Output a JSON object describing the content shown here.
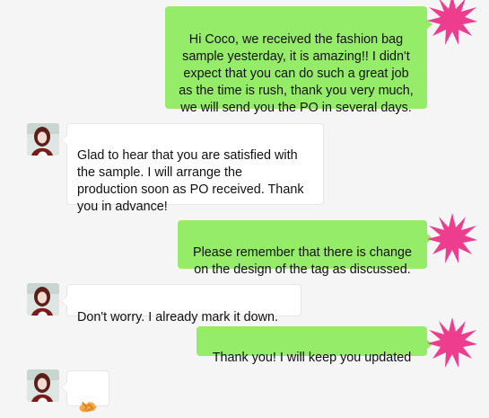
{
  "colors": {
    "outgoing_bubble": "#95ec69",
    "incoming_bubble": "#ffffff",
    "background": "#f5f5f5",
    "star_accent": "#ee3d8f"
  },
  "messages": [
    {
      "sender": "self",
      "text": "Hi Coco, we received the fashion bag\nsample yesterday, it is amazing!! I didn't\nexpect that you can do such a great job\nas the time is rush, thank you very much,\nwe will send you the PO in several days."
    },
    {
      "sender": "other",
      "text": "Glad to hear that you are satisfied with\nthe sample. I will arrange the\nproduction soon as PO received. Thank\nyou in advance!"
    },
    {
      "sender": "self",
      "text": "Please remember that there is change\non the design of the tag as discussed."
    },
    {
      "sender": "other",
      "text": "Don't worry. I already mark it down."
    },
    {
      "sender": "self",
      "text": "Thank you! I will keep you updated"
    },
    {
      "sender": "other",
      "icon": "handshake-emoji"
    }
  ],
  "icons": {
    "self_avatar": "pink-star-avatar",
    "other_avatar": "profile-photo-avatar"
  }
}
